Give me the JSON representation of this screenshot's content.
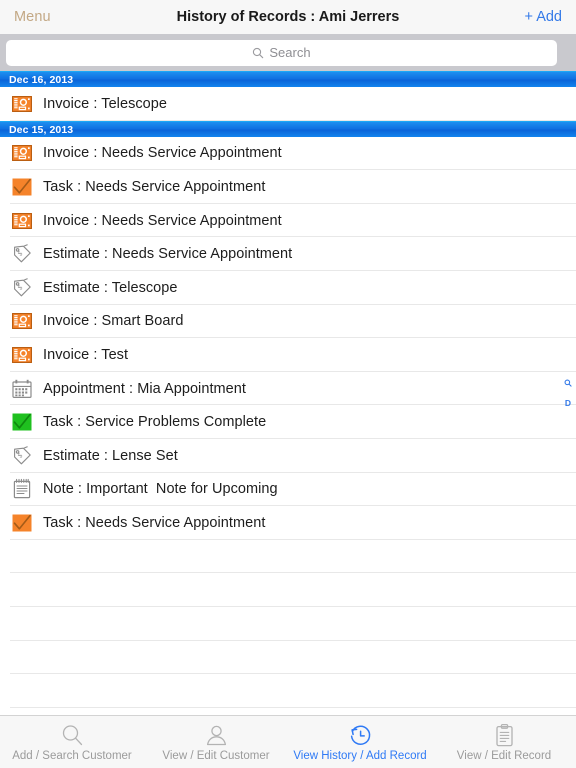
{
  "navbar": {
    "menu_label": "Menu",
    "title": "History of Records : Ami Jerrers",
    "add_label": "+ Add",
    "menu_color": "#c3a885",
    "add_color": "#3379e8"
  },
  "search": {
    "placeholder": "Search",
    "value": "",
    "icon": "search-icon"
  },
  "index_bar": {
    "items": [
      "search-icon",
      "D"
    ]
  },
  "list": {
    "sections": [
      {
        "date": "Dec 16, 2013",
        "rows": [
          {
            "icon": "invoice-icon",
            "label": "Invoice : Telescope"
          }
        ]
      },
      {
        "date": "Dec 15, 2013",
        "rows": [
          {
            "icon": "invoice-icon",
            "label": "Invoice : Needs Service Appointment"
          },
          {
            "icon": "task-open-icon",
            "label": "Task : Needs Service Appointment"
          },
          {
            "icon": "invoice-icon",
            "label": "Invoice : Needs Service Appointment"
          },
          {
            "icon": "estimate-icon",
            "label": "Estimate : Needs Service Appointment"
          },
          {
            "icon": "estimate-icon",
            "label": "Estimate : Telescope"
          },
          {
            "icon": "invoice-icon",
            "label": "Invoice : Smart Board"
          },
          {
            "icon": "invoice-icon",
            "label": "Invoice : Test"
          },
          {
            "icon": "appointment-icon",
            "label": "Appointment : Mia Appointment"
          },
          {
            "icon": "task-complete-icon",
            "label": "Task : Service Problems Complete"
          },
          {
            "icon": "estimate-icon",
            "label": "Estimate : Lense Set"
          },
          {
            "icon": "note-icon",
            "label": "Note : Important  Note for Upcoming"
          },
          {
            "icon": "task-open-icon",
            "label": "Task : Needs Service Appointment"
          }
        ]
      }
    ],
    "blank_row_count": 6,
    "separator_color": "#e8e8e8"
  },
  "colors": {
    "section_header_blue": "#0e6fe0",
    "accent_blue": "#2f7af5",
    "icon_orange": "#f5832a",
    "icon_green": "#1fc01f",
    "searchbar_gray": "#c9c9ce"
  },
  "tabbar": {
    "tabs": [
      {
        "icon": "magnifier-icon",
        "label": "Add / Search Customer",
        "active": false
      },
      {
        "icon": "person-icon",
        "label": "View / Edit Customer",
        "active": false
      },
      {
        "icon": "history-clock-icon",
        "label": "View History / Add Record",
        "active": true
      },
      {
        "icon": "clipboard-icon",
        "label": "View / Edit Record",
        "active": false
      }
    ]
  }
}
